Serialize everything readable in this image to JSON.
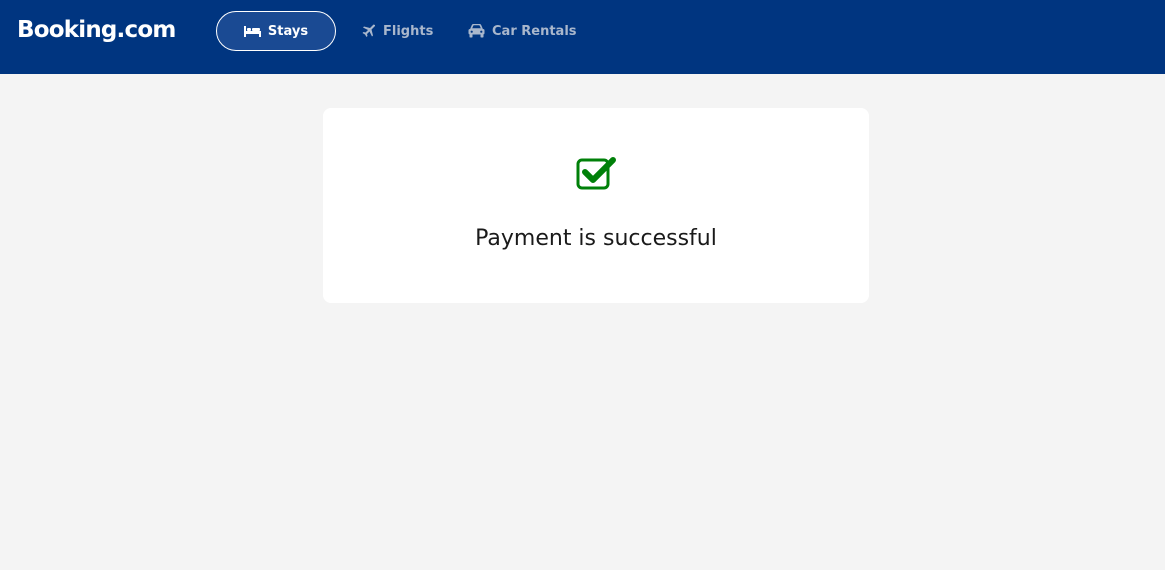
{
  "header": {
    "logo_text": "Booking.com",
    "background_color": "#003580",
    "tabs": [
      {
        "label": "Stays",
        "icon": "bed-icon",
        "active": true
      },
      {
        "label": "Flights",
        "icon": "airplane-icon",
        "active": false
      },
      {
        "label": "Car Rentals",
        "icon": "car-icon",
        "active": false
      }
    ]
  },
  "main": {
    "status_icon": "check-square-icon",
    "status_color": "#008009",
    "message": "Payment is successful"
  }
}
